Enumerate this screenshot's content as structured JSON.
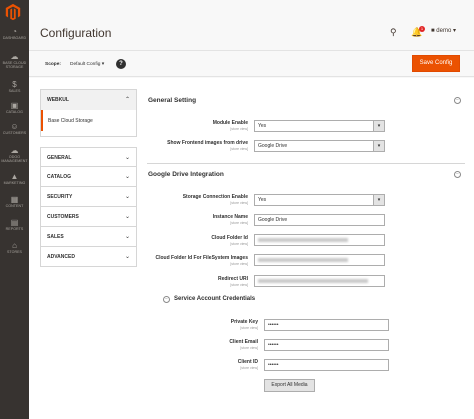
{
  "nav": {
    "items": [
      {
        "label": "Dashboard",
        "icon": "gauge-icon"
      },
      {
        "label": "Base Cloud Storage",
        "icon": "cloud-icon"
      },
      {
        "label": "Sales",
        "icon": "dollar-icon"
      },
      {
        "label": "Catalog",
        "icon": "cube-icon"
      },
      {
        "label": "Customers",
        "icon": "person-icon"
      },
      {
        "label": "Odoo Management",
        "icon": "cloud-icon"
      },
      {
        "label": "Marketing",
        "icon": "megaphone-icon"
      },
      {
        "label": "Content",
        "icon": "layout-icon"
      },
      {
        "label": "Reports",
        "icon": "bar-chart-icon"
      },
      {
        "label": "Stores",
        "icon": "store-icon"
      }
    ]
  },
  "header": {
    "title": "Configuration",
    "notification_count": "1",
    "user": "demo"
  },
  "scope": {
    "label": "Scope:",
    "value": "Default Config",
    "help": "?"
  },
  "toolbar": {
    "save_label": "Save Config"
  },
  "tabs": {
    "active_group": "WEBKUL",
    "active_item": "Base Cloud Storage",
    "groups": [
      "GENERAL",
      "CATALOG",
      "SECURITY",
      "CUSTOMERS",
      "SALES",
      "ADVANCED"
    ]
  },
  "general_setting": {
    "title": "General Setting",
    "module_enable": {
      "label": "Module Enable",
      "scope": "[store view]",
      "value": "Yes"
    },
    "show_frontend": {
      "label": "Show Frontend images from drive",
      "scope": "[store view]",
      "value": "Google Drive"
    }
  },
  "gdrive": {
    "title": "Google Drive Integration",
    "storage_connection": {
      "label": "Storage Connection Enable",
      "scope": "[store view]",
      "value": "Yes"
    },
    "instance_name": {
      "label": "Instance Name",
      "scope": "[store view]",
      "value": "Google Drive"
    },
    "cloud_folder_id": {
      "label": "Cloud Folder Id",
      "scope": "[store view]"
    },
    "filesystem_folder": {
      "label": "Cloud Folder Id For FileSystem Images",
      "scope": "[store view]"
    },
    "redirect_uri": {
      "label": "Redirect URI",
      "scope": "[store view]"
    }
  },
  "service_account": {
    "title": "Service Account Credentials",
    "private_key": {
      "label": "Private Key",
      "scope": "[store view]",
      "value": "••••••"
    },
    "client_email": {
      "label": "Client Email",
      "scope": "[store view]",
      "value": "••••••"
    },
    "client_id": {
      "label": "Client ID",
      "scope": "[store view]",
      "value": "••••••"
    },
    "export_label": "Export All Media"
  },
  "colors": {
    "accent": "#eb5202",
    "nav_bg": "#373330"
  }
}
